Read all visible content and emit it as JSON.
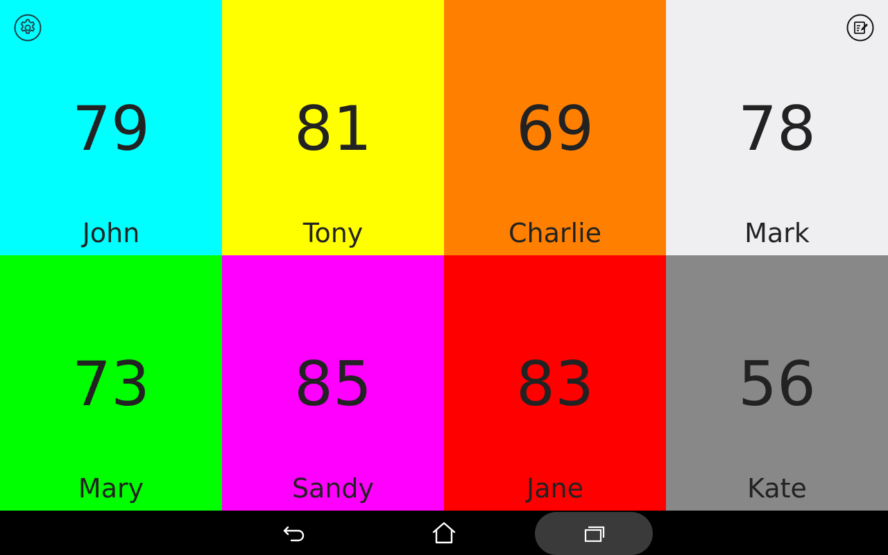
{
  "players": [
    {
      "score": "79",
      "name": "John",
      "color": "#00FFFF"
    },
    {
      "score": "81",
      "name": "Tony",
      "color": "#FFFF00"
    },
    {
      "score": "69",
      "name": "Charlie",
      "color": "#FF8000"
    },
    {
      "score": "78",
      "name": "Mark",
      "color": "#EFEFF1"
    },
    {
      "score": "73",
      "name": "Mary",
      "color": "#00FF00"
    },
    {
      "score": "85",
      "name": "Sandy",
      "color": "#FF00FF"
    },
    {
      "score": "83",
      "name": "Jane",
      "color": "#FF0000"
    },
    {
      "score": "56",
      "name": "Kate",
      "color": "#888888"
    }
  ],
  "toolbar": {
    "settings_icon": "gear-icon",
    "edit_icon": "edit-note-icon"
  },
  "navbar": {
    "back_icon": "back-icon",
    "home_icon": "home-icon",
    "recents_icon": "recent-apps-icon"
  }
}
